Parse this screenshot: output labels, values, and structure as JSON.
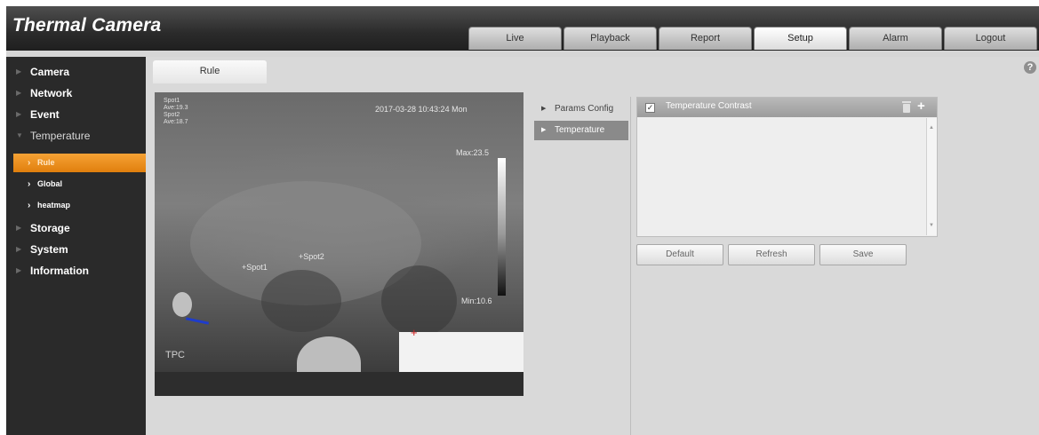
{
  "app": {
    "title": "Thermal Camera"
  },
  "nav": {
    "tabs": [
      {
        "label": "Live"
      },
      {
        "label": "Playback"
      },
      {
        "label": "Report"
      },
      {
        "label": "Setup",
        "active": true
      },
      {
        "label": "Alarm"
      },
      {
        "label": "Logout"
      }
    ]
  },
  "sidebar": {
    "items": [
      {
        "label": "Camera"
      },
      {
        "label": "Network"
      },
      {
        "label": "Event"
      },
      {
        "label": "Temperature",
        "expanded": true
      },
      {
        "label": "Storage"
      },
      {
        "label": "System"
      },
      {
        "label": "Information"
      }
    ],
    "sub_items": [
      {
        "label": "Rule",
        "active": true
      },
      {
        "label": "Global"
      },
      {
        "label": "heatmap"
      }
    ]
  },
  "page": {
    "tab_label": "Rule",
    "help_glyph": "?"
  },
  "video": {
    "spots_info": [
      "Spot1",
      "Ave:19.3",
      "Spot2",
      "Ave:18.7"
    ],
    "timestamp": "2017-03-28 10:43:24 Mon",
    "max_label": "Max:23.5",
    "min_label": "Min:10.6",
    "spot1_label": "+Spot1",
    "spot2_label": "+Spot2",
    "channel_label": "TPC"
  },
  "submenu": {
    "items": [
      {
        "label": "Params Config"
      },
      {
        "label": "Temperature",
        "active": true
      }
    ]
  },
  "rules": {
    "rows": [
      {
        "checked": true,
        "checkmark": "✓",
        "name": "Temperature Contrast"
      }
    ]
  },
  "buttons": {
    "default_label": "Default",
    "refresh_label": "Refresh",
    "save_label": "Save"
  },
  "colors": {
    "accent": "#e8891c",
    "header": "#2b2b2b",
    "sidebar": "#2a2a2a"
  }
}
